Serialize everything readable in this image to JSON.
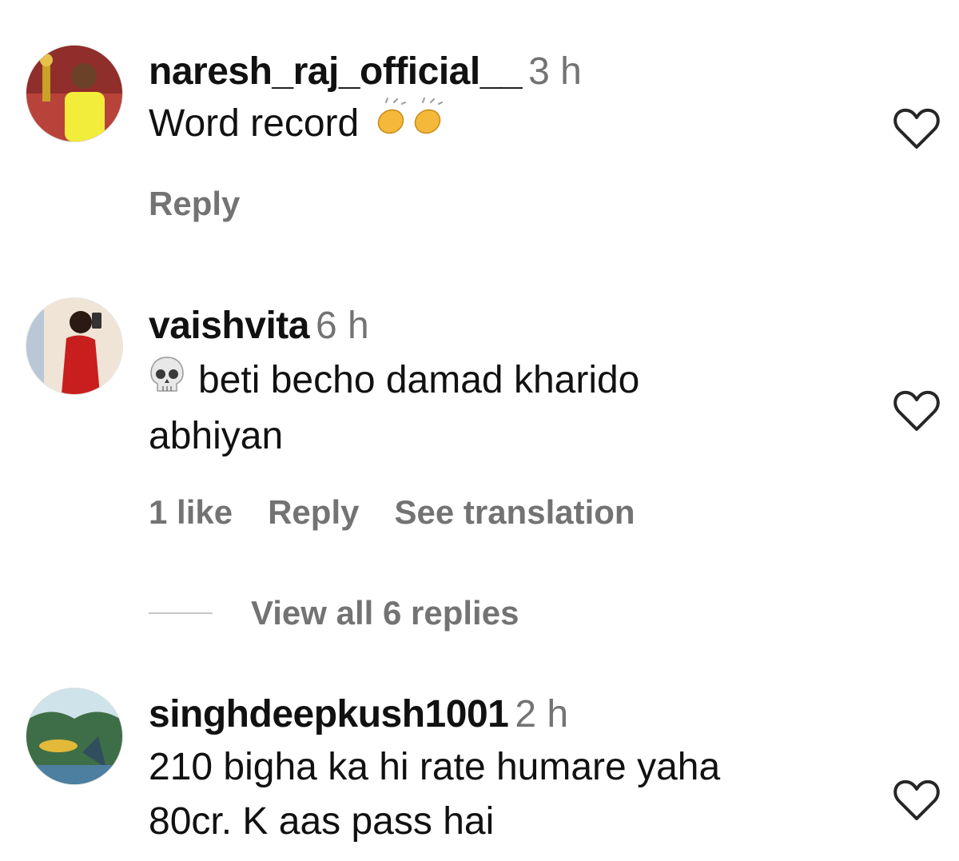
{
  "comments": [
    {
      "username": "naresh_raj_official__",
      "time": "3 h",
      "text_lines": [
        "Word record"
      ],
      "emoji": "clapping-hands",
      "actions": {
        "reply": "Reply"
      }
    },
    {
      "username": "vaishvita",
      "time": "6 h",
      "emoji": "skull",
      "text_lines": [
        "beti becho damad kharido",
        "abhiyan"
      ],
      "actions": {
        "likes": "1 like",
        "reply": "Reply",
        "translate": "See translation"
      },
      "view_replies": "View all 6 replies"
    },
    {
      "username": "singhdeepkush1001",
      "time": "2 h",
      "text_lines": [
        "210 bigha ka hi rate humare yaha",
        "80cr. K aas pass hai"
      ]
    }
  ],
  "colors": {
    "primary_text": "#111111",
    "secondary_text": "#737373",
    "divider": "#c7c7c7"
  }
}
